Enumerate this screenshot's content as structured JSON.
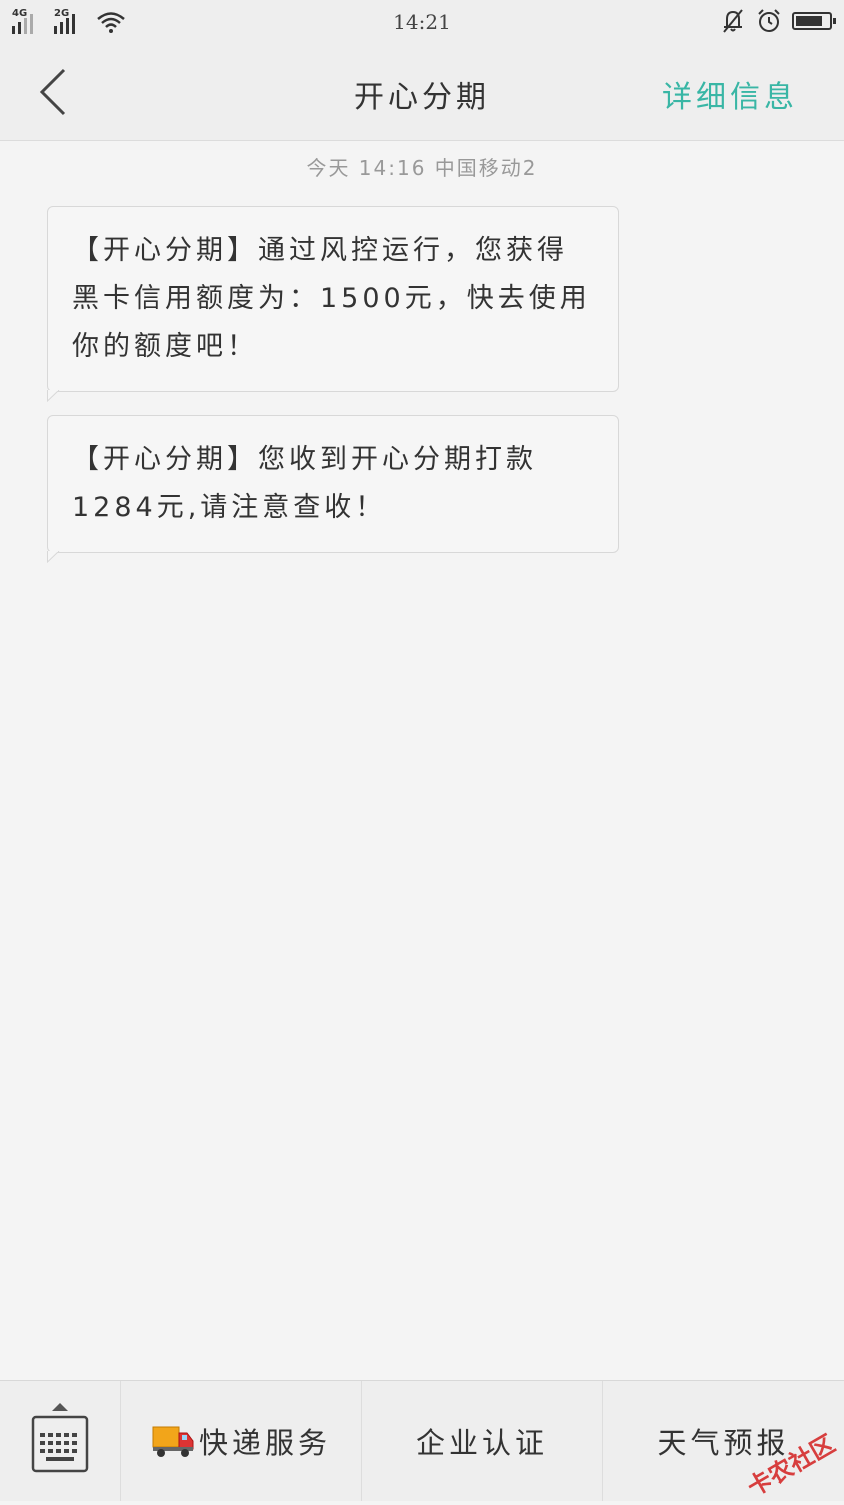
{
  "status_bar": {
    "time": "14:21",
    "sim1_network": "4G",
    "sim2_network": "2G",
    "icons": [
      "signal-icon",
      "wifi-icon",
      "notification-off-icon",
      "alarm-icon",
      "battery-icon"
    ]
  },
  "header": {
    "title": "开心分期",
    "details_label": "详细信息",
    "accent_color": "#39b6a5"
  },
  "conversation": {
    "timestamp": "今天  14:16  中国移动2",
    "messages": [
      {
        "text": "【开心分期】通过风控运行，您获得黑卡信用额度为：1500元，快去使用你的额度吧！"
      },
      {
        "text": "【开心分期】您收到开心分期打款1284元,请注意查收！"
      }
    ]
  },
  "bottom_bar": {
    "quick_actions": [
      {
        "label": "快递服务",
        "icon": "delivery-truck-icon"
      },
      {
        "label": "企业认证"
      },
      {
        "label": "天气预报"
      }
    ],
    "watermark": "卡农社区"
  }
}
